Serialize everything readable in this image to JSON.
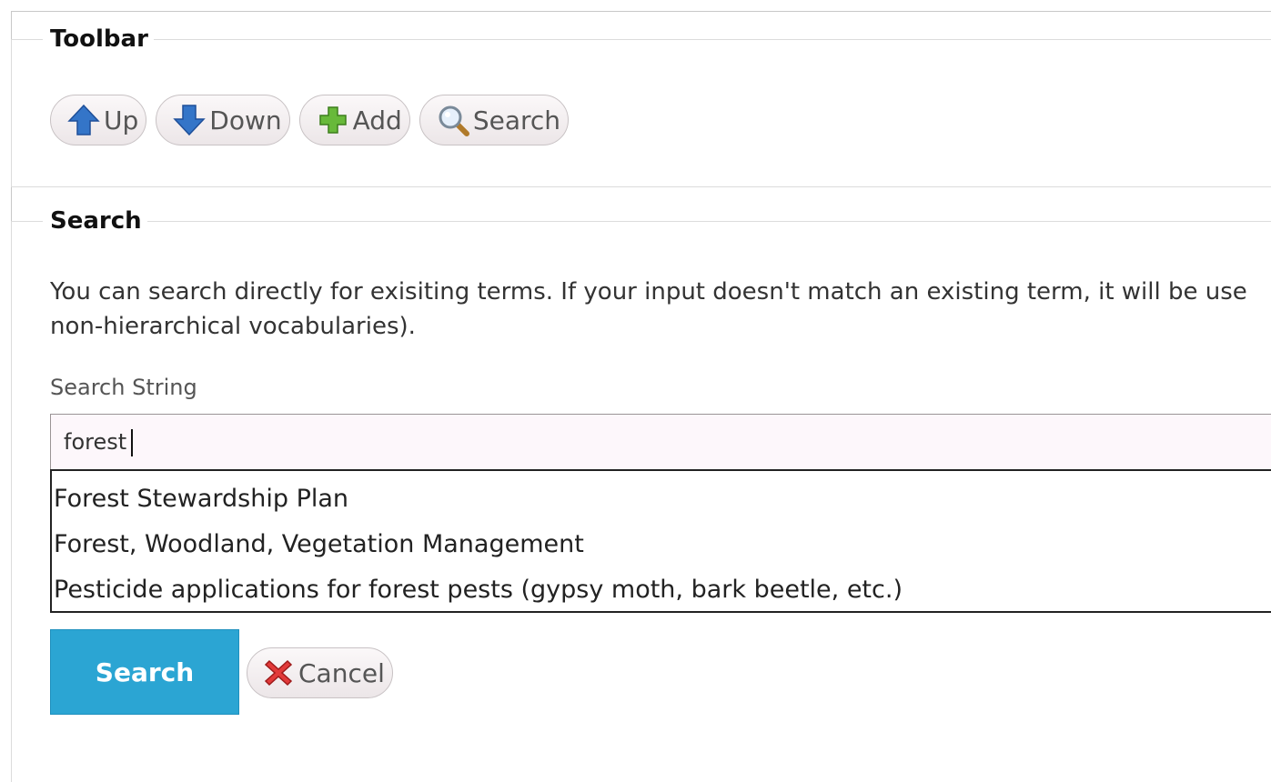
{
  "toolbar": {
    "legend": "Toolbar",
    "buttons": [
      {
        "label": "Up",
        "icon": "arrow-up-icon"
      },
      {
        "label": "Down",
        "icon": "arrow-down-icon"
      },
      {
        "label": "Add",
        "icon": "plus-icon"
      },
      {
        "label": "Search",
        "icon": "magnifier-icon"
      }
    ]
  },
  "search": {
    "legend": "Search",
    "description_line1": "You can search directly for exisiting terms. If your input doesn't match an existing term, it will be use",
    "description_line2": "non-hierarchical vocabularies).",
    "field_label": "Search String",
    "input_value": "forest",
    "suggestions": [
      "Forest Stewardship Plan",
      "Forest, Woodland, Vegetation Management",
      "Pesticide applications for forest pests (gypsy moth, bark beetle, etc.)"
    ],
    "submit_label": "Search",
    "cancel_label": "Cancel",
    "cancel_icon": "red-x-icon"
  },
  "colors": {
    "primary_button": "#2ba5d3",
    "input_background": "#fdf7fb",
    "up_down_arrow": "#2f6fc4",
    "add_plus": "#5cb230",
    "cancel_x": "#e03a3a"
  }
}
